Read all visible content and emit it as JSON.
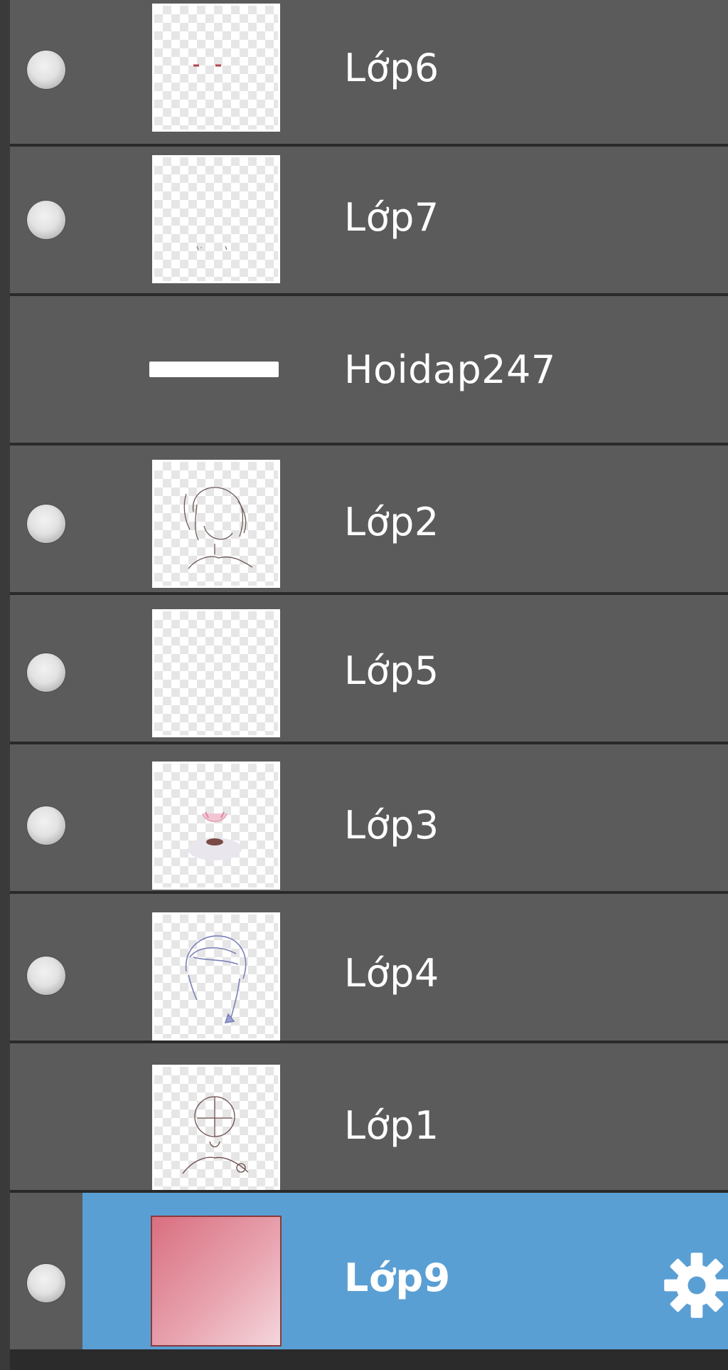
{
  "layers": [
    {
      "name": "Lớp6",
      "visible": true,
      "thumbnail": "red-eyes-marks",
      "selected": false
    },
    {
      "name": "Lớp7",
      "visible": true,
      "thumbnail": "faint-marks",
      "selected": false
    },
    {
      "name": "Hoidap247",
      "visible": false,
      "thumbnail": "text-strip",
      "selected": false
    },
    {
      "name": "Lớp2",
      "visible": true,
      "thumbnail": "sketch-head",
      "selected": false
    },
    {
      "name": "Lớp5",
      "visible": true,
      "thumbnail": "empty",
      "selected": false
    },
    {
      "name": "Lớp3",
      "visible": true,
      "thumbnail": "pink-blush",
      "selected": false
    },
    {
      "name": "Lớp4",
      "visible": true,
      "thumbnail": "blue-hair",
      "selected": false
    },
    {
      "name": "Lớp1",
      "visible": false,
      "thumbnail": "rough-sketch",
      "selected": false
    },
    {
      "name": "Lớp9",
      "visible": true,
      "thumbnail": "pink-gradient",
      "selected": true
    }
  ],
  "icons": {
    "visibility": "visibility-dot-icon",
    "settings": "gear-icon"
  },
  "colors": {
    "row_background": "#5b5b5b",
    "separator": "#2a2a2a",
    "selected_background": "#5a9fd4",
    "text": "#ffffff",
    "gradient_thumb_start": "#d96f80",
    "gradient_thumb_end": "#f5d6dc"
  }
}
